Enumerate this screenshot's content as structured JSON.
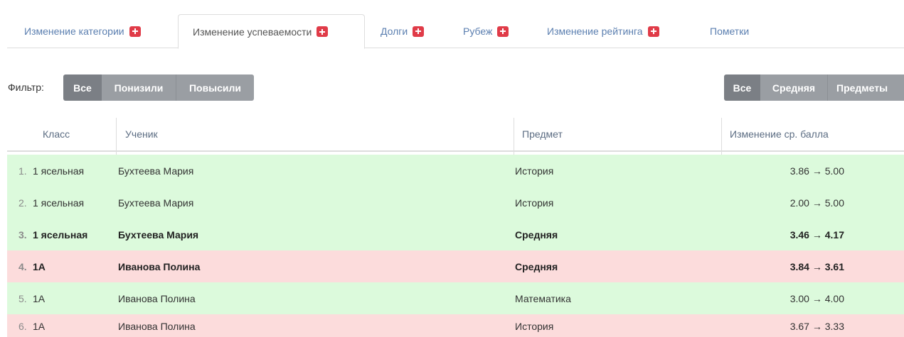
{
  "tabs": [
    {
      "label": "Изменение категории",
      "badge": true,
      "active": false
    },
    {
      "label": "Изменение успеваемости",
      "badge": true,
      "active": true
    },
    {
      "label": "Долги",
      "badge": true,
      "active": false
    },
    {
      "label": "Рубеж",
      "badge": true,
      "active": false
    },
    {
      "label": "Изменение рейтинга",
      "badge": true,
      "active": false
    },
    {
      "label": "Пометки",
      "badge": false,
      "active": false
    }
  ],
  "filter": {
    "label": "Фильтр:",
    "direction_buttons": [
      "Все",
      "Понизили",
      "Повысили"
    ],
    "direction_selected": "Все",
    "scope_buttons": [
      "Все",
      "Средняя",
      "Предметы"
    ],
    "scope_selected": "Все"
  },
  "table": {
    "headers": [
      "Класс",
      "Ученик",
      "Предмет",
      "Изменение ср. балла"
    ],
    "rows": [
      {
        "num": "1.",
        "class": "1 ясельная",
        "student": "Бухтеева Мария",
        "subject": "История",
        "change": "3.86 → 5.00",
        "trend": "up",
        "bold": false
      },
      {
        "num": "2.",
        "class": "1 ясельная",
        "student": "Бухтеева Мария",
        "subject": "История",
        "change": "2.00 → 5.00",
        "trend": "up",
        "bold": false
      },
      {
        "num": "3.",
        "class": "1 ясельная",
        "student": "Бухтеева Мария",
        "subject": "Средняя",
        "change": "3.46 → 4.17",
        "trend": "up",
        "bold": true
      },
      {
        "num": "4.",
        "class": "1А",
        "student": "Иванова Полина",
        "subject": "Средняя",
        "change": "3.84 → 3.61",
        "trend": "down",
        "bold": true
      },
      {
        "num": "5.",
        "class": "1А",
        "student": "Иванова Полина",
        "subject": "Математика",
        "change": "3.00 → 4.00",
        "trend": "up",
        "bold": false
      },
      {
        "num": "6.",
        "class": "1А",
        "student": "Иванова Полина",
        "subject": "История",
        "change": "3.67 → 3.33",
        "trend": "down",
        "bold": false
      }
    ]
  },
  "colors": {
    "tab_link": "#5b7fb0",
    "badge": "#e03b48",
    "row_up": "#dcfadc",
    "row_down": "#fcdcdc",
    "button_selected": "#7b7f85",
    "button": "#9a9ea3"
  }
}
